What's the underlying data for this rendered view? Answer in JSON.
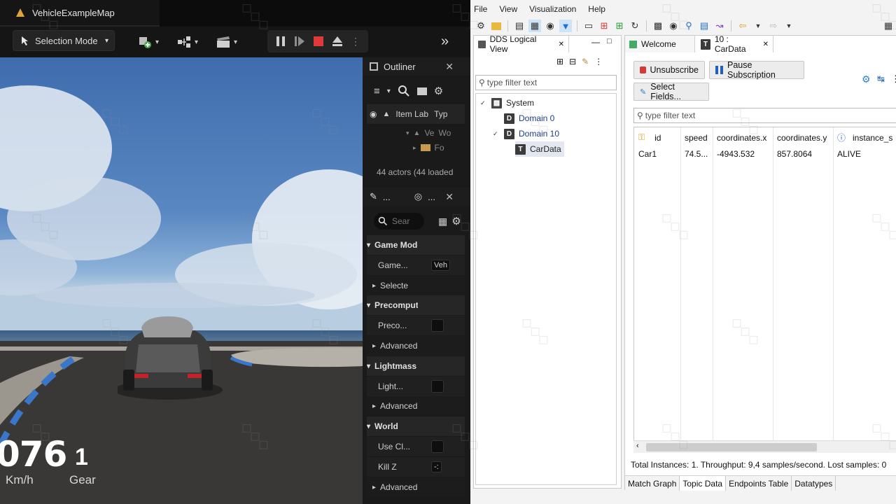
{
  "ue": {
    "title": "VehicleExampleMap",
    "selection_mode": "Selection Mode",
    "hud": {
      "speed": "076",
      "speed_unit": "Km/h",
      "gear": "1",
      "gear_label": "Gear"
    },
    "outliner": {
      "title": "Outliner",
      "column_label": "Item Lab",
      "column_type": "Typ",
      "row1_label": "Ve",
      "row1_type": "Wo",
      "row2_label": "Fo",
      "status": "44 actors (44 loaded"
    },
    "details": {
      "tab_label": "...",
      "search_placeholder": "Sear",
      "rows": [
        {
          "kind": "cat",
          "label": "Game Mode"
        },
        {
          "kind": "prop",
          "label": "Game...",
          "value": "Veh"
        },
        {
          "kind": "adv",
          "label": "Selecte"
        },
        {
          "kind": "cat",
          "label": "Precomputed Visibil"
        },
        {
          "kind": "prop",
          "label": "Preco..."
        },
        {
          "kind": "adv",
          "label": "Advanced"
        },
        {
          "kind": "cat",
          "label": "Lightmass"
        },
        {
          "kind": "prop",
          "label": "Light..."
        },
        {
          "kind": "adv",
          "label": "Advanced"
        },
        {
          "kind": "cat",
          "label": "World"
        },
        {
          "kind": "prop",
          "label": "Use Cl..."
        },
        {
          "kind": "prop",
          "label": "Kill Z",
          "value": "-:"
        },
        {
          "kind": "adv",
          "label": "Advanced"
        }
      ]
    }
  },
  "dds": {
    "menu": [
      "File",
      "View",
      "Visualization",
      "Help"
    ],
    "logical_view": {
      "tab_label": "DDS Logical View",
      "filter_placeholder": "type filter text",
      "tree": {
        "system": "System",
        "domain0": "Domain 0",
        "domain10": "Domain 10",
        "topic": "CarData"
      }
    },
    "topic_view": {
      "tab_welcome": "Welcome",
      "tab_topic": "10 : CarData",
      "btn_unsubscribe": "Unsubscribe",
      "btn_pause": "Pause Subscription",
      "btn_select_fields": "Select Fields...",
      "filter_placeholder": "type filter text",
      "columns": [
        "id",
        "speed",
        "coordinates.x",
        "coordinates.y",
        "instance_s"
      ],
      "rows": [
        [
          "Car1",
          "74.5...",
          "-4943.532",
          "857.8064",
          "ALIVE"
        ]
      ],
      "status": "Total Instances: 1. Throughput: 9,4 samples/second. Lost samples: 0",
      "bottom_tabs": [
        "Match Graph",
        "Topic Data",
        "Endpoints Table",
        "Datatypes"
      ]
    },
    "colors": {
      "accent_blue": "#1a3e8a",
      "pause_blue": "#1f5fbf",
      "unsub_red": "#d23a3a"
    }
  }
}
